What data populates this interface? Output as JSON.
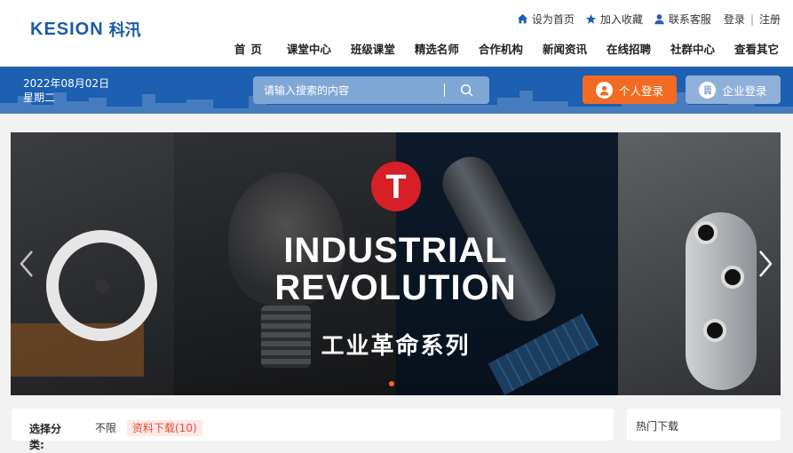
{
  "header": {
    "logo_en": "KESION",
    "logo_cn": "科汛",
    "top_links": [
      {
        "icon": "home-icon",
        "label": "设为首页"
      },
      {
        "icon": "star-icon",
        "label": "加入收藏"
      },
      {
        "icon": "user-service-icon",
        "label": "联系客服"
      }
    ],
    "login": "登录",
    "separator": "|",
    "register": "注册",
    "nav": [
      "首页",
      "课堂中心",
      "班级课堂",
      "精选名师",
      "合作机构",
      "新闻资讯",
      "在线招聘",
      "社群中心",
      "查看其它"
    ]
  },
  "bar": {
    "date": "2022年08月02日",
    "weekday": "星期二",
    "search_placeholder": "请输入搜索的内容",
    "personal_login": "个人登录",
    "company_login": "企业登录"
  },
  "banner": {
    "logo_letter": "T",
    "headline_line1": "INDUSTRIAL",
    "headline_line2": "REVOLUTION",
    "subtitle": "工业革命系列",
    "active_slide": 1,
    "colors": {
      "logo": "#d61f26",
      "active_dot": "#f36a22"
    }
  },
  "filter": {
    "label": "选择分类:",
    "options": [
      "不限",
      "资料下载(10)"
    ],
    "selected": "资料下载(10)"
  },
  "hot_panel": {
    "title": "热门下载"
  },
  "colors": {
    "brand_blue": "#1d5fb0",
    "accent_orange": "#f36a22"
  }
}
